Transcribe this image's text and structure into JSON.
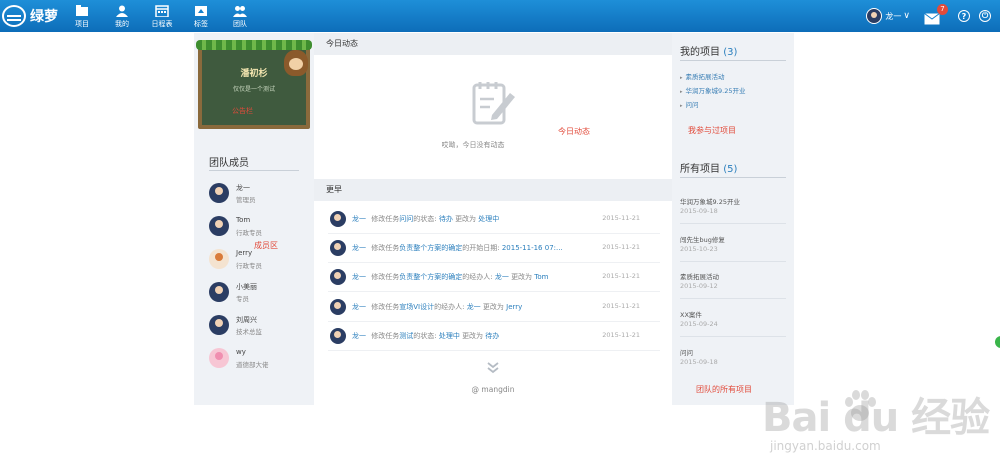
{
  "app": {
    "logo_text": "绿萝"
  },
  "nav": [
    {
      "label": "项目",
      "icon": "folder-icon"
    },
    {
      "label": "我的",
      "icon": "user-icon"
    },
    {
      "label": "日程表",
      "icon": "calendar-icon"
    },
    {
      "label": "标签",
      "icon": "tag-icon"
    },
    {
      "label": "团队",
      "icon": "team-icon"
    }
  ],
  "topbar_right": {
    "user_name": "龙一",
    "caret": "∨",
    "mail_badge": "7",
    "help": "?",
    "power": "⏻"
  },
  "board": {
    "title": "潘初杉",
    "subtitle": "仅仅是一个测试",
    "note": "公告栏"
  },
  "team": {
    "title": "团队成员",
    "members": [
      {
        "name": "龙一",
        "role": "管理员",
        "avatar": "man"
      },
      {
        "name": "Tom",
        "role": "行政专员",
        "avatar": "man"
      },
      {
        "name": "Jerry",
        "role": "行政专员",
        "avatar": "kid"
      },
      {
        "name": "小美丽",
        "role": "专员",
        "avatar": "man"
      },
      {
        "name": "刘周兴",
        "role": "技术总监",
        "avatar": "man"
      },
      {
        "name": "wy",
        "role": "道德部大佬",
        "avatar": "flower"
      }
    ],
    "annotation": "成员区"
  },
  "today": {
    "title": "今日动态",
    "empty_text": "哎呦，今日没有动态",
    "annotation": "今日动态"
  },
  "earlier": {
    "title": "更早",
    "activities": [
      {
        "user": "龙一",
        "action": "修改任务",
        "task": "问问",
        "field": "的状态:",
        "from": "待办",
        "change": "更改为",
        "to": "处理中",
        "date": "2015-11-21"
      },
      {
        "user": "龙一",
        "action": "修改任务",
        "task": "负责整个方案的确定",
        "field": "的开始日期:",
        "from": "2015-11-16 07:...",
        "change": "",
        "to": "",
        "date": "2015-11-21"
      },
      {
        "user": "龙一",
        "action": "修改任务",
        "task": "负责整个方案的确定",
        "field": "的经办人:",
        "from": "龙一",
        "change": "更改为",
        "to": "Tom",
        "date": "2015-11-21"
      },
      {
        "user": "龙一",
        "action": "修改任务",
        "task": "宣场VI设计",
        "field": "的经办人:",
        "from": "龙一",
        "change": "更改为",
        "to": "Jerry",
        "date": "2015-11-21"
      },
      {
        "user": "龙一",
        "action": "修改任务",
        "task": "测试",
        "field": "的状态:",
        "from": "处理中",
        "change": "更改为",
        "to": "待办",
        "date": "2015-11-21"
      }
    ],
    "footer": "@ mangdin"
  },
  "my_projects": {
    "title": "我的项目",
    "count": "(3)",
    "items": [
      "素质拓展活动",
      "华润万象城9.25开业",
      "问问"
    ],
    "annotation": "我参与过项目"
  },
  "all_projects": {
    "title": "所有项目",
    "count": "(5)",
    "items": [
      {
        "name": "华润万象城9.25开业",
        "date": "2015-09-18"
      },
      {
        "name": "闯先生bug修复",
        "date": "2015-10-23"
      },
      {
        "name": "素质拓展活动",
        "date": "2015-09-12"
      },
      {
        "name": "XX案件",
        "date": "2015-09-24"
      },
      {
        "name": "问问",
        "date": "2015-09-18"
      }
    ],
    "annotation": "团队的所有项目"
  },
  "watermark": {
    "main": "Bai du 经验",
    "sub": "jingyan.baidu.com"
  },
  "colors": {
    "topbar": "#1580cc",
    "link": "#2b7fbd",
    "annotation": "#e24b3b"
  }
}
